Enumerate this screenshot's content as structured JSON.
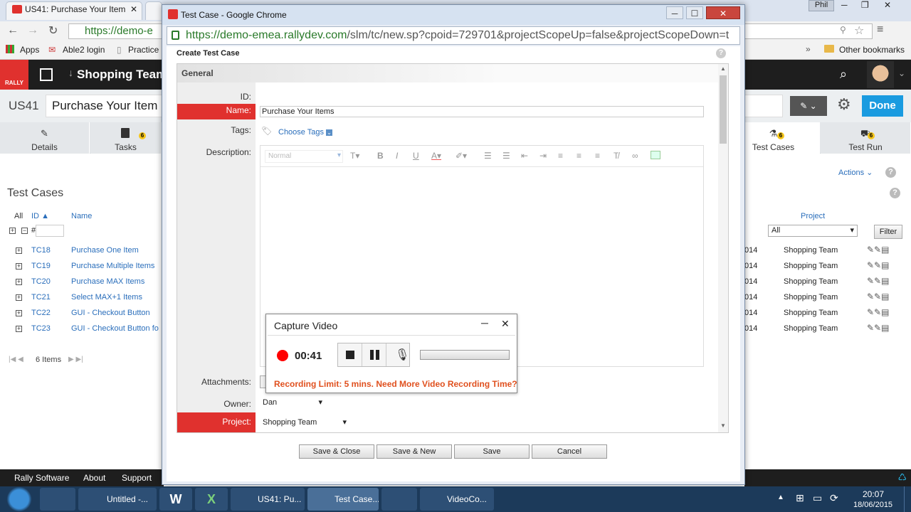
{
  "background_browser": {
    "tab1_title": "US41: Purchase Your Item",
    "tab2_title": "",
    "url_partial": "https://demo-e",
    "user_badge": "Phil",
    "bookmarks": [
      "Apps",
      "Able2 login",
      "Practice"
    ],
    "other_bookmarks": "Other bookmarks"
  },
  "rally": {
    "logo_text": "RALLY",
    "project_title": "Shopping Team",
    "story_id": "US41",
    "story_name": "Purchase Your Item",
    "done_label": "Done",
    "tabs": [
      {
        "label": "Details",
        "icon": "pencil-icon",
        "badge": ""
      },
      {
        "label": "Tasks",
        "icon": "clipboard-icon",
        "badge": "6"
      },
      {
        "label": "Test Cases",
        "icon": "flask-icon",
        "badge": "6"
      },
      {
        "label": "Test Run",
        "icon": "cart-icon",
        "badge": "6"
      }
    ],
    "actions_label": "Actions",
    "section_title": "Test Cases",
    "columns": {
      "all": "All",
      "id": "ID",
      "name": "Name",
      "project": "Project"
    },
    "id_filter_prefix": "#",
    "project_filter_value": "All",
    "filter_button": "Filter",
    "rows": [
      {
        "id": "TC18",
        "name": "Purchase One Item",
        "date_frag": "014",
        "project": "Shopping Team"
      },
      {
        "id": "TC19",
        "name": "Purchase Multiple Items",
        "date_frag": "014",
        "project": "Shopping Team"
      },
      {
        "id": "TC20",
        "name": "Purchase MAX Items",
        "date_frag": "014",
        "project": "Shopping Team"
      },
      {
        "id": "TC21",
        "name": "Select MAX+1 Items",
        "date_frag": "014",
        "project": "Shopping Team"
      },
      {
        "id": "TC22",
        "name": "GUI - Checkout Button",
        "date_frag": "014",
        "project": "Shopping Team"
      },
      {
        "id": "TC23",
        "name": "GUI - Checkout Button fo",
        "date_frag": "014",
        "project": "Shopping Team"
      }
    ],
    "pager_text": "6 Items",
    "footer_links": [
      "Rally Software",
      "About",
      "Support"
    ]
  },
  "popup": {
    "window_title": "Test Case - Google Chrome",
    "url_host": "https://demo-emea.rallydev.com",
    "url_path": "/slm/tc/new.sp?cpoid=729701&projectScopeUp=false&projectScopeDown=t",
    "heading": "Create Test Case",
    "section_header": "General",
    "fields": {
      "id_label": "ID:",
      "name_label": "Name:",
      "name_value": "Purchase Your Items",
      "tags_label": "Tags:",
      "choose_tags": "Choose Tags",
      "description_label": "Description:",
      "editor_style": "Normal",
      "attachments_label": "Attachments:",
      "owner_label": "Owner:",
      "owner_value": "Dan",
      "project_label": "Project:",
      "project_value": "Shopping Team"
    },
    "buttons": [
      "Save & Close",
      "Save & New",
      "Save",
      "Cancel"
    ]
  },
  "capture_video": {
    "title": "Capture Video",
    "timer": "00:41",
    "limit_message": "Recording Limit: 5 mins. Need More Video Recording Time?"
  },
  "taskbar": {
    "items": [
      {
        "label": "Untitled -..."
      },
      {
        "label": "US41: Pu..."
      },
      {
        "label": "Test Case..."
      },
      {
        "label": "VideoCo..."
      }
    ],
    "time": "20:07",
    "date": "18/06/2015"
  },
  "colors": {
    "rally_red": "#e0312e",
    "link_blue": "#2a6ebb",
    "done_blue": "#1a9be0",
    "record_red": "#ff0000",
    "warning_orange": "#e0501e"
  }
}
